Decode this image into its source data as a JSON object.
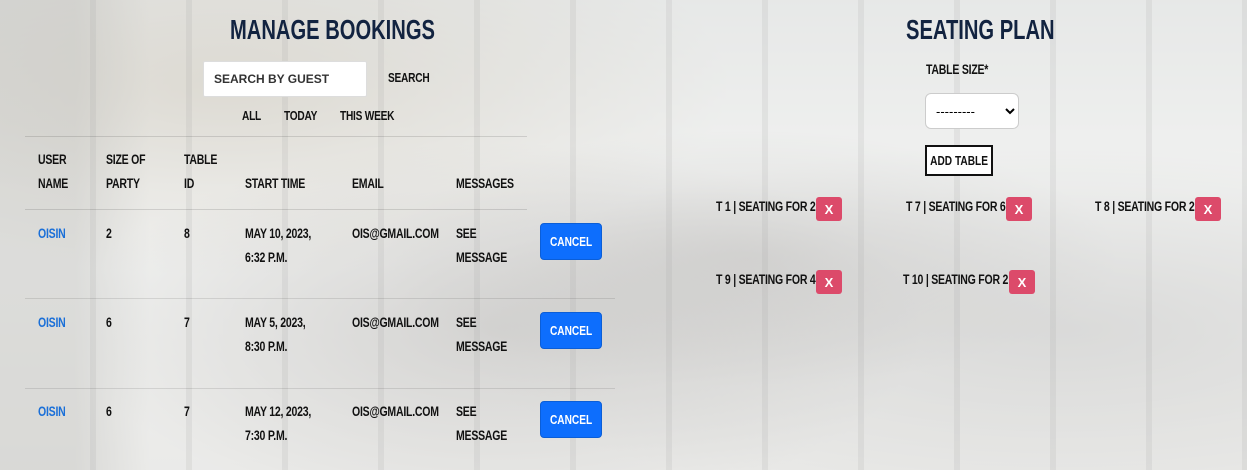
{
  "manage": {
    "title": "Manage Bookings",
    "search_placeholder": "Search by guest",
    "search_label": "Search",
    "filters": [
      "All",
      "Today",
      "This Week"
    ],
    "columns": {
      "user_1": "User",
      "user_2": "Name",
      "party_1": "Size of",
      "party_2": "Party",
      "table_1": "Table",
      "table_2": "ID",
      "start": "Start Time",
      "email": "Email",
      "messages": "Messages"
    },
    "rows": [
      {
        "user": "Oisin",
        "size": "2",
        "table": "8",
        "time_1": "May 10, 2023,",
        "time_2": "6:32 p.m.",
        "email": "ois@gmail.com",
        "msg_1": "See",
        "msg_2": "Message",
        "cancel": "Cancel"
      },
      {
        "user": "Oisin",
        "size": "6",
        "table": "7",
        "time_1": "May 5, 2023,",
        "time_2": "8:30 p.m.",
        "email": "ois@gmail.com",
        "msg_1": "See",
        "msg_2": "Message",
        "cancel": "Cancel"
      },
      {
        "user": "Oisin",
        "size": "6",
        "table": "7",
        "time_1": "May 12, 2023,",
        "time_2": "7:30 p.m.",
        "email": "ois@gmail.com",
        "msg_1": "See",
        "msg_2": "Message",
        "cancel": "Cancel"
      }
    ]
  },
  "seating": {
    "title": "Seating Plan",
    "table_size_label": "Table size*",
    "table_size_value": "---------",
    "add_table": "Add Table",
    "tables": [
      {
        "label": "T 1 | Seating for 2",
        "remove": "X"
      },
      {
        "label": "T 7 | Seating for 6",
        "remove": "X"
      },
      {
        "label": "T 8 | Seating for 2",
        "remove": "X"
      },
      {
        "label": "T 9 | Seating for 4",
        "remove": "X"
      },
      {
        "label": "T 10 | Seating for 2",
        "remove": "X"
      }
    ]
  },
  "colors": {
    "heading": "#122340",
    "link": "#1a6fd8",
    "cancel": "#0d6efd",
    "remove": "#dc4a6a"
  }
}
